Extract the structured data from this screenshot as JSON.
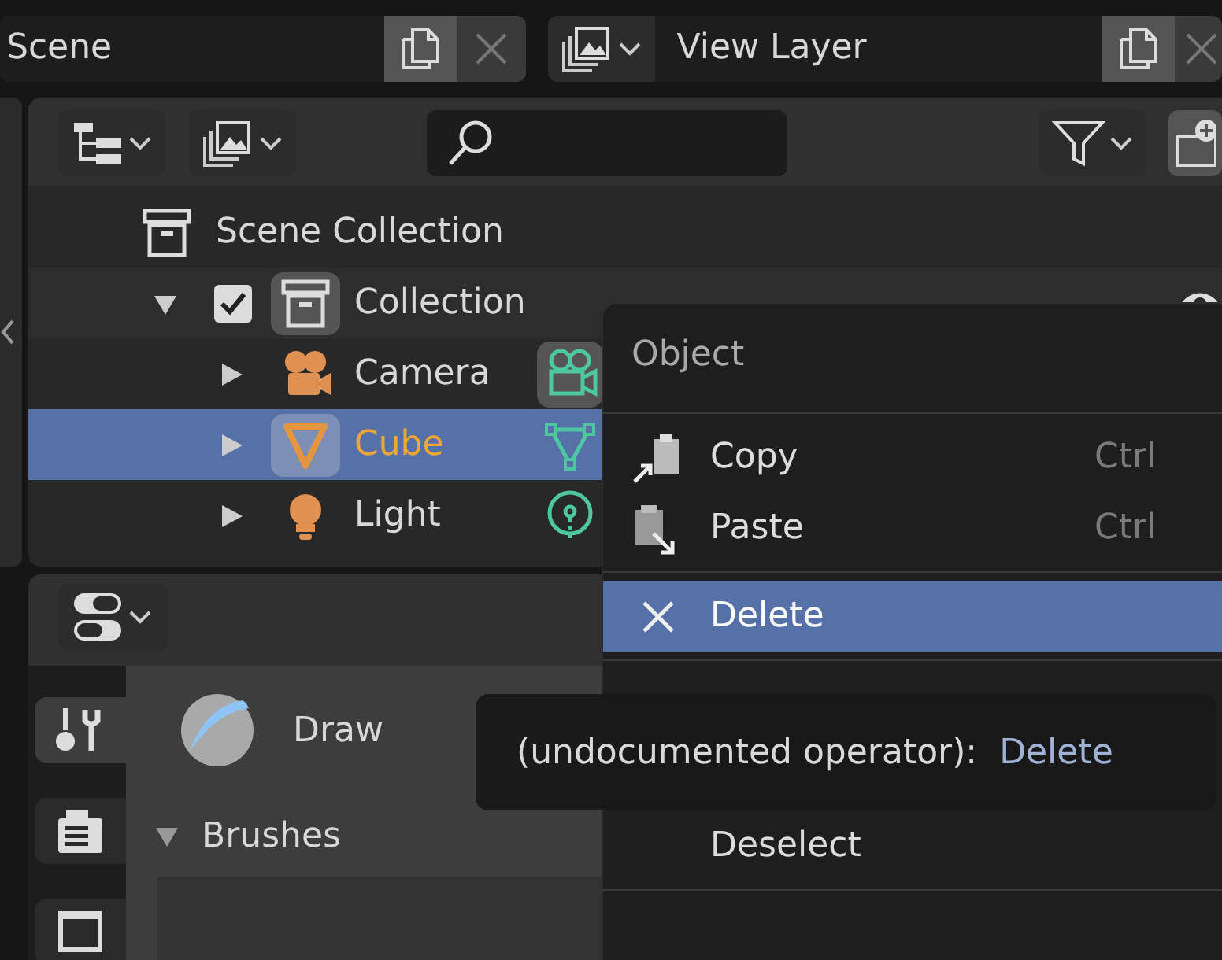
{
  "top_bar": {
    "scene": "Scene",
    "view_layer": "View Layer"
  },
  "outliner": {
    "tree": [
      {
        "label": "Scene Collection",
        "kind": "collection",
        "selected": false,
        "children": [
          {
            "label": "Collection",
            "kind": "collection",
            "expanded": true,
            "checked": true,
            "active": true,
            "visible": true,
            "selected": false,
            "children": [
              {
                "label": "Camera",
                "kind": "camera",
                "data_active": true,
                "expanded": false,
                "active": false,
                "selected": false
              },
              {
                "label": "Cube",
                "kind": "mesh",
                "data_active": false,
                "expanded": false,
                "active": true,
                "selected": true
              },
              {
                "label": "Light",
                "kind": "light",
                "data_active": false,
                "expanded": false,
                "active": false,
                "selected": false
              }
            ]
          }
        ]
      }
    ]
  },
  "properties": {
    "tabs": [
      {
        "kind": "tool",
        "selected": true
      },
      {
        "kind": "render",
        "selected": false
      },
      {
        "kind": "output",
        "selected": false
      }
    ],
    "tool": {
      "name": "Draw"
    },
    "panel": {
      "title": "Brushes",
      "expanded": true
    }
  },
  "context_menu": {
    "title": "Object",
    "items": [
      {
        "kind": "separator"
      },
      {
        "kind": "copy",
        "label": "Copy",
        "shortcut": "Ctrl",
        "selected": false
      },
      {
        "kind": "paste",
        "label": "Paste",
        "shortcut": "Ctrl",
        "selected": false
      },
      {
        "kind": "separator"
      },
      {
        "kind": "delete",
        "label": "Delete",
        "selected": true
      },
      {
        "kind": "separator"
      },
      {
        "kind": "gap"
      },
      {
        "kind": "gap"
      },
      {
        "kind": "plain",
        "label": "Deselect",
        "selected": false
      },
      {
        "kind": "separator"
      }
    ]
  },
  "tooltip": {
    "text": "(undocumented operator):",
    "operator": "Delete"
  }
}
